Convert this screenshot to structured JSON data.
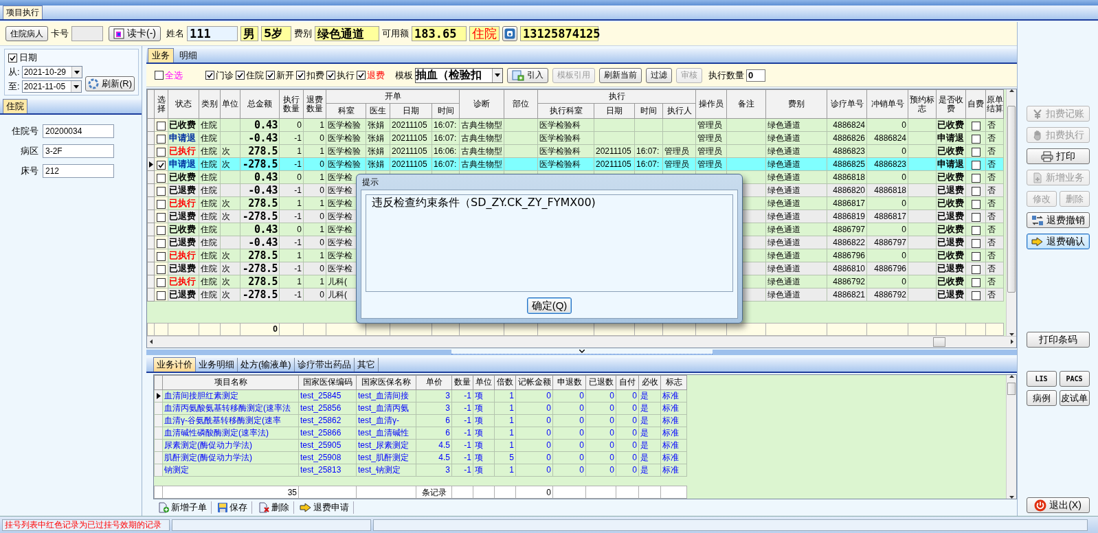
{
  "window": {
    "tab": "项目执行"
  },
  "patient": {
    "type_button": "住院病人",
    "card_label": "卡号",
    "read_card_button": "读卡(-)",
    "name_label": "姓名",
    "name": "111",
    "sex": "男",
    "age": "5岁",
    "fee_type_label": "费别",
    "fee_type": "绿色通道",
    "balance_label": "可用额",
    "balance": "183.65",
    "visit_type": "住院",
    "phone": "13125874125"
  },
  "date_filter": {
    "checked": true,
    "label": "日期",
    "from_label": "从:",
    "from": "2021-10-29",
    "to_label": "至:",
    "to": "2021-11-05",
    "refresh_button": "刷新(R)"
  },
  "inpatient": {
    "tab": "住院",
    "fields": [
      {
        "label": "住院号",
        "value": "20200034"
      },
      {
        "label": "病区",
        "value": "3-2F"
      },
      {
        "label": "床号",
        "value": "212"
      }
    ]
  },
  "main_tabs": [
    {
      "label": "业务",
      "selected": true
    },
    {
      "label": "明细",
      "selected": false
    }
  ],
  "filters": [
    {
      "label": "全选",
      "checked": false,
      "kind": "select_all"
    },
    {
      "label": "门诊",
      "checked": true,
      "kind": "normal"
    },
    {
      "label": "住院",
      "checked": true,
      "kind": "normal"
    },
    {
      "label": "新开",
      "checked": true,
      "kind": "normal"
    },
    {
      "label": "扣费",
      "checked": true,
      "kind": "normal"
    },
    {
      "label": "执行",
      "checked": true,
      "kind": "normal"
    },
    {
      "label": "退费",
      "checked": true,
      "kind": "refund"
    }
  ],
  "template": {
    "label": "模板",
    "value": "抽血（检验扣"
  },
  "toolbar_buttons": [
    {
      "label": "引入",
      "kind": "import",
      "disabled": false
    },
    {
      "label": "模板引用",
      "kind": "plain",
      "disabled": true
    },
    {
      "label": "刷新当前",
      "kind": "plain",
      "disabled": false
    },
    {
      "label": "过滤",
      "kind": "plain",
      "disabled": false
    },
    {
      "label": "审核",
      "kind": "plain",
      "disabled": true
    }
  ],
  "exec_count": {
    "label": "执行数量",
    "value": "0"
  },
  "grid": {
    "columns": [
      {
        "label": "选择"
      },
      {
        "label": "状态"
      },
      {
        "label": "类别"
      },
      {
        "label": "单位"
      },
      {
        "label": "总金额"
      },
      {
        "label": "执行数量"
      },
      {
        "label": "退费数量"
      },
      {
        "label": "开单",
        "children": [
          {
            "label": "科室"
          },
          {
            "label": "医生"
          },
          {
            "label": "日期"
          },
          {
            "label": "时间"
          }
        ]
      },
      {
        "label": "诊断"
      },
      {
        "label": "部位"
      },
      {
        "label": "执行",
        "children": [
          {
            "label": "执行科室"
          },
          {
            "label": "日期"
          },
          {
            "label": "时间"
          },
          {
            "label": "执行人"
          }
        ]
      },
      {
        "label": "操作员"
      },
      {
        "label": "备注"
      },
      {
        "label": "费别"
      },
      {
        "label": "诊疗单号"
      },
      {
        "label": "冲销单号"
      },
      {
        "label": "预约标志"
      },
      {
        "label": "是否收费"
      },
      {
        "label": "自费"
      },
      {
        "label": "原单结算"
      }
    ],
    "rows": [
      {
        "selected": false,
        "checked": false,
        "kind": "charged",
        "status": "已收费",
        "category": "住院",
        "total": "0.43",
        "exec_qty": "0",
        "refund_qty": "1",
        "dept": "医学检验",
        "doctor": "张娟",
        "date": "20211105",
        "time": "16:07:",
        "diagnosis": "古典生物型",
        "exec_dept": "医学检验科",
        "operator": "管理员",
        "fee_type": "绿色通道",
        "order_no": "4886824",
        "reversal_no": "0",
        "charged": "已收费",
        "self_pay": false,
        "original_settled": "否"
      },
      {
        "selected": false,
        "checked": false,
        "kind": "requested",
        "status": "申请退",
        "category": "住院",
        "total": "-0.43",
        "exec_qty": "-1",
        "refund_qty": "0",
        "dept": "医学检验",
        "doctor": "张娟",
        "date": "20211105",
        "time": "16:07:",
        "diagnosis": "古典生物型",
        "exec_dept": "医学检验科",
        "operator": "管理员",
        "fee_type": "绿色通道",
        "order_no": "4886826",
        "reversal_no": "4886824",
        "charged": "申请退",
        "self_pay": false,
        "original_settled": "否"
      },
      {
        "selected": false,
        "checked": false,
        "kind": "executed",
        "status": "已执行",
        "category": "住院",
        "unit": "次",
        "total": "278.5",
        "exec_qty": "1",
        "refund_qty": "1",
        "dept": "医学检验",
        "doctor": "张娟",
        "date": "20211105",
        "time": "16:06:",
        "diagnosis": "古典生物型",
        "exec_dept": "医学检验科",
        "exec_date": "20211105",
        "exec_time": "16:07:",
        "executor": "管理员",
        "operator": "管理员",
        "fee_type": "绿色通道",
        "order_no": "4886823",
        "reversal_no": "0",
        "charged": "已收费",
        "self_pay": false,
        "original_settled": "否"
      },
      {
        "selected": true,
        "checked": true,
        "kind": "requested",
        "status": "申请退",
        "category": "住院",
        "unit": "次",
        "total": "-278.5",
        "exec_qty": "-1",
        "refund_qty": "0",
        "dept": "医学检验",
        "doctor": "张娟",
        "date": "20211105",
        "time": "16:07:",
        "diagnosis": "古典生物型",
        "exec_dept": "医学检验科",
        "exec_date": "20211105",
        "exec_time": "16:07:",
        "executor": "管理员",
        "operator": "管理员",
        "fee_type": "绿色通道",
        "order_no": "4886825",
        "reversal_no": "4886823",
        "charged": "申请退",
        "self_pay": false,
        "original_settled": "否"
      },
      {
        "selected": false,
        "checked": false,
        "kind": "charged",
        "status": "已收费",
        "category": "住院",
        "total": "0.43",
        "exec_qty": "0",
        "refund_qty": "1",
        "dept": "医学检",
        "fee_type": "绿色通道",
        "order_no": "4886818",
        "reversal_no": "0",
        "charged": "已收费",
        "self_pay": false,
        "original_settled": "否"
      },
      {
        "selected": false,
        "checked": false,
        "kind": "refunded",
        "status": "已退费",
        "category": "住院",
        "total": "-0.43",
        "exec_qty": "-1",
        "refund_qty": "0",
        "dept": "医学检",
        "fee_type": "绿色通道",
        "order_no": "4886820",
        "reversal_no": "4886818",
        "charged": "已退费",
        "self_pay": false,
        "original_settled": "否"
      },
      {
        "selected": false,
        "checked": false,
        "kind": "executed",
        "status": "已执行",
        "category": "住院",
        "unit": "次",
        "total": "278.5",
        "exec_qty": "1",
        "refund_qty": "1",
        "dept": "医学检",
        "fee_type": "绿色通道",
        "order_no": "4886817",
        "reversal_no": "0",
        "charged": "已收费",
        "self_pay": false,
        "original_settled": "否"
      },
      {
        "selected": false,
        "checked": false,
        "kind": "refunded",
        "status": "已退费",
        "category": "住院",
        "unit": "次",
        "total": "-278.5",
        "exec_qty": "-1",
        "refund_qty": "0",
        "dept": "医学检",
        "fee_type": "绿色通道",
        "order_no": "4886819",
        "reversal_no": "4886817",
        "charged": "已退费",
        "self_pay": false,
        "original_settled": "否"
      },
      {
        "selected": false,
        "checked": false,
        "kind": "charged",
        "status": "已收费",
        "category": "住院",
        "total": "0.43",
        "exec_qty": "0",
        "refund_qty": "1",
        "dept": "医学检",
        "fee_type": "绿色通道",
        "order_no": "4886797",
        "reversal_no": "0",
        "charged": "已收费",
        "self_pay": false,
        "original_settled": "否"
      },
      {
        "selected": false,
        "checked": false,
        "kind": "refunded",
        "status": "已退费",
        "category": "住院",
        "total": "-0.43",
        "exec_qty": "-1",
        "refund_qty": "0",
        "dept": "医学检",
        "fee_type": "绿色通道",
        "order_no": "4886822",
        "reversal_no": "4886797",
        "charged": "已退费",
        "self_pay": false,
        "original_settled": "否"
      },
      {
        "selected": false,
        "checked": false,
        "kind": "executed",
        "status": "已执行",
        "category": "住院",
        "unit": "次",
        "total": "278.5",
        "exec_qty": "1",
        "refund_qty": "1",
        "dept": "医学检",
        "fee_type": "绿色通道",
        "order_no": "4886796",
        "reversal_no": "0",
        "charged": "已收费",
        "self_pay": false,
        "original_settled": "否"
      },
      {
        "selected": false,
        "checked": false,
        "kind": "refunded",
        "status": "已退费",
        "category": "住院",
        "unit": "次",
        "total": "-278.5",
        "exec_qty": "-1",
        "refund_qty": "0",
        "dept": "医学检",
        "fee_type": "绿色通道",
        "order_no": "4886810",
        "reversal_no": "4886796",
        "charged": "已退费",
        "self_pay": false,
        "original_settled": "否"
      },
      {
        "selected": false,
        "checked": false,
        "kind": "executed",
        "status": "已执行",
        "category": "住院",
        "unit": "次",
        "total": "278.5",
        "exec_qty": "1",
        "refund_qty": "1",
        "dept": "儿科(",
        "fee_type": "绿色通道",
        "order_no": "4886792",
        "reversal_no": "0",
        "charged": "已收费",
        "self_pay": false,
        "original_settled": "否"
      },
      {
        "selected": false,
        "checked": false,
        "kind": "refunded",
        "status": "已退费",
        "category": "住院",
        "unit": "次",
        "total": "-278.5",
        "exec_qty": "-1",
        "refund_qty": "0",
        "dept": "儿科(",
        "fee_type": "绿色通道",
        "order_no": "4886821",
        "reversal_no": "4886792",
        "charged": "已退费",
        "self_pay": false,
        "original_settled": "否"
      }
    ],
    "footer": {
      "total": "0"
    }
  },
  "sub_tabs": [
    {
      "label": "业务计价",
      "selected": true
    },
    {
      "label": "业务明细",
      "selected": false
    },
    {
      "label": "处方(输液单)",
      "selected": false
    },
    {
      "label": "诊疗带出药品",
      "selected": false
    },
    {
      "label": "其它",
      "selected": false
    }
  ],
  "sub_grid": {
    "columns": [
      "项目名称",
      "国家医保编码",
      "国家医保名称",
      "单价",
      "数量",
      "单位",
      "倍数",
      "记帐金额",
      "申退数",
      "已退数",
      "自付",
      "必收",
      "标志"
    ],
    "rows": [
      {
        "selected": true,
        "cells": [
          "血清间接胆红素测定",
          "test_25845",
          "test_血清间接",
          "3",
          "-1",
          "项",
          "1",
          "0",
          "0",
          "0",
          "0",
          "是",
          "标准"
        ]
      },
      {
        "selected": false,
        "cells": [
          "血清丙氨酸氨基转移酶测定(速率法",
          "test_25856",
          "test_血清丙氨",
          "3",
          "-1",
          "项",
          "1",
          "0",
          "0",
          "0",
          "0",
          "是",
          "标准"
        ]
      },
      {
        "selected": false,
        "cells": [
          "血清γ-谷氨酰基转移酶测定(速率",
          "test_25862",
          "test_血清γ-",
          "6",
          "-1",
          "项",
          "1",
          "0",
          "0",
          "0",
          "0",
          "是",
          "标准"
        ]
      },
      {
        "selected": false,
        "cells": [
          "血清碱性磷酸酶测定(速率法)",
          "test_25866",
          "test_血清碱性",
          "6",
          "-1",
          "项",
          "1",
          "0",
          "0",
          "0",
          "0",
          "是",
          "标准"
        ]
      },
      {
        "selected": false,
        "cells": [
          "尿素测定(酶促动力学法)",
          "test_25905",
          "test_尿素测定",
          "4.5",
          "-1",
          "项",
          "1",
          "0",
          "0",
          "0",
          "0",
          "是",
          "标准"
        ]
      },
      {
        "selected": false,
        "cells": [
          "肌酐测定(酶促动力学法)",
          "test_25908",
          "test_肌酐测定",
          "4.5",
          "-1",
          "项",
          "5",
          "0",
          "0",
          "0",
          "0",
          "是",
          "标准"
        ]
      },
      {
        "selected": false,
        "cells": [
          "钠测定",
          "test_25813",
          "test_钠测定",
          "3",
          "-1",
          "项",
          "1",
          "0",
          "0",
          "0",
          "0",
          "是",
          "标准"
        ]
      }
    ],
    "footer": {
      "count": "35",
      "records_label": "条记录",
      "amount": "0"
    }
  },
  "sub_toolbar": [
    {
      "label": "新增子单",
      "kind": "add"
    },
    {
      "label": "保存",
      "kind": "save"
    },
    {
      "label": "删除",
      "kind": "delete"
    },
    {
      "label": "退费申请",
      "kind": "arrow"
    }
  ],
  "side_sections": [
    {
      "rows": [
        [
          {
            "label": "扣费记账",
            "kind": "yen",
            "disabled": true,
            "focused": false
          }
        ],
        [
          {
            "label": "扣费执行",
            "kind": "hand",
            "disabled": true,
            "focused": false
          }
        ],
        [
          {
            "label": "打印",
            "kind": "printer",
            "disabled": false,
            "focused": false
          }
        ],
        [
          {
            "label": "新增业务",
            "kind": "doc",
            "disabled": true,
            "focused": false
          }
        ],
        [
          {
            "label": "修改",
            "kind": "plain",
            "disabled": true,
            "focused": false
          },
          {
            "label": "删除",
            "kind": "plain",
            "disabled": true,
            "focused": false
          }
        ],
        [
          {
            "label": "退费撤销",
            "kind": "swap",
            "disabled": false,
            "focused": false
          }
        ],
        [
          {
            "label": "退费确认",
            "kind": "arrow",
            "disabled": false,
            "focused": true
          }
        ]
      ]
    },
    {
      "rows": [
        [
          {
            "label": "打印条码",
            "kind": "plain",
            "disabled": false,
            "focused": false
          }
        ]
      ]
    },
    {
      "rows": [
        [
          {
            "label": "LIS",
            "kind": "small",
            "disabled": false,
            "focused": false
          },
          {
            "label": "PACS",
            "kind": "small",
            "disabled": false,
            "focused": false
          }
        ],
        [
          {
            "label": "病例",
            "kind": "plain",
            "disabled": false,
            "focused": false
          },
          {
            "label": "皮试单",
            "kind": "plain",
            "disabled": false,
            "focused": false
          }
        ]
      ]
    },
    {
      "rows": [
        [
          {
            "label": "退出(X)",
            "kind": "power",
            "disabled": false,
            "focused": false
          }
        ]
      ]
    }
  ],
  "dialog": {
    "title": "提示",
    "message": "违反检查约束条件（SD_ZY.CK_ZY_FYMX00)",
    "button": "确定(Q)"
  },
  "status_bar": {
    "message": "挂号列表中红色记录为已过挂号效期的记录"
  }
}
